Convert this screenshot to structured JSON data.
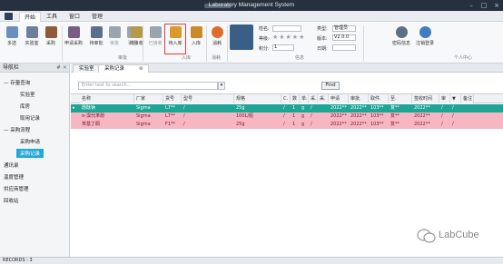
{
  "window": {
    "title": "Laboratory Management System"
  },
  "menu": {
    "tabs": [
      "开始",
      "工具",
      "窗口",
      "管理"
    ],
    "active_index": 0
  },
  "ribbon": {
    "buttons": [
      {
        "label": "多选",
        "color": "#6a8fbf"
      },
      {
        "label": "实验室",
        "color": "#6d7f99"
      },
      {
        "label": "采购",
        "color": "#8e5a3a"
      },
      {
        "label": "申请采购",
        "color": "#7a5d86"
      },
      {
        "label": "待审批",
        "color": "#5b6f8b"
      },
      {
        "label": "审批",
        "color": "#9aa4b0"
      },
      {
        "label": "驳回",
        "color": "#9aa4b0"
      },
      {
        "label": "待接收",
        "color": "#b49a4a"
      },
      {
        "label": "已接收",
        "color": "#9aa4b0"
      },
      {
        "label": "待入库",
        "color": "#d99a2b"
      },
      {
        "label": "入库",
        "color": "#c98a2a"
      },
      {
        "label": "消耗",
        "color": "#e06b2a"
      },
      {
        "label": "密码信息",
        "color": "#5d6f88"
      },
      {
        "label": "注销登录",
        "color": "#3f7fbf"
      }
    ],
    "groups": [
      "审批",
      "入库",
      "消耗",
      "信息",
      "个人中心"
    ],
    "user": {
      "name_label": "姓名:",
      "name_value": "",
      "rank_label": "等级:",
      "rating": 2,
      "score_label": "积分:",
      "score_value": "1",
      "type_label": "类型:",
      "type_value": "管理员",
      "version_label": "版本:",
      "version_value": "V2.0.0",
      "date_label": "日期:",
      "date_value": ""
    }
  },
  "nav": {
    "title": "导航栏",
    "pin": "# ×",
    "items": [
      {
        "label": "— 存量查询",
        "level": 0
      },
      {
        "label": "实验室",
        "level": 1
      },
      {
        "label": "库房",
        "level": 1
      },
      {
        "label": "取用记录",
        "level": 1
      },
      {
        "label": "— 采购流程",
        "level": 0
      },
      {
        "label": "采购申请",
        "level": 1
      },
      {
        "label": "采购记录",
        "level": 1,
        "selected": true
      },
      {
        "label": "通讯录",
        "level": 0
      },
      {
        "label": "温度管理",
        "level": 0
      },
      {
        "label": "供应商管理",
        "level": 0
      },
      {
        "label": "回收站",
        "level": 0
      }
    ]
  },
  "doctabs": [
    {
      "label": "实验室",
      "active": false
    },
    {
      "label": "采购记录",
      "active": true,
      "close": "⊗"
    }
  ],
  "filter": {
    "placeholder": "Enter text to search...",
    "find_label": "Find"
  },
  "grid": {
    "columns": [
      "名称",
      "厂家",
      "货号",
      "型号",
      "规格",
      "C.",
      "数",
      "单.",
      "采.",
      "采.",
      "申请",
      "审批.",
      "取件.",
      "至.",
      "签收时间",
      "审",
      "▼",
      "入.",
      "备注"
    ],
    "rows": [
      {
        "style": "sel",
        "marker": "▸",
        "cells": [
          "酚酞钠",
          "Sigma",
          "L7**",
          "/",
          "25g",
          "/",
          "1",
          "g",
          "/",
          "",
          "2022**",
          "2022**",
          "103**",
          "复**",
          "2022**",
          "/",
          "/",
          "",
          ""
        ]
      },
      {
        "style": "pink",
        "marker": "",
        "cells": [
          "α-溴代苯酚",
          "Sigma",
          "L7**",
          "/",
          "100L/瓶",
          "/",
          "1",
          "g",
          "/",
          "",
          "2022**",
          "2022**",
          "103**",
          "复**",
          "2022**",
          "/",
          "/",
          "",
          ""
        ]
      },
      {
        "style": "pink",
        "marker": "",
        "cells": [
          "苯基丁酮",
          "Sigma",
          "F1**",
          "/",
          "25g",
          "/",
          "1",
          "g",
          "/",
          "",
          "2022**",
          "2022**",
          "103**",
          "复**",
          "2022**",
          "/",
          "/",
          "",
          ""
        ]
      }
    ]
  },
  "status": {
    "text": "RECORDS : 3"
  },
  "watermark": {
    "text": "LabCube"
  }
}
